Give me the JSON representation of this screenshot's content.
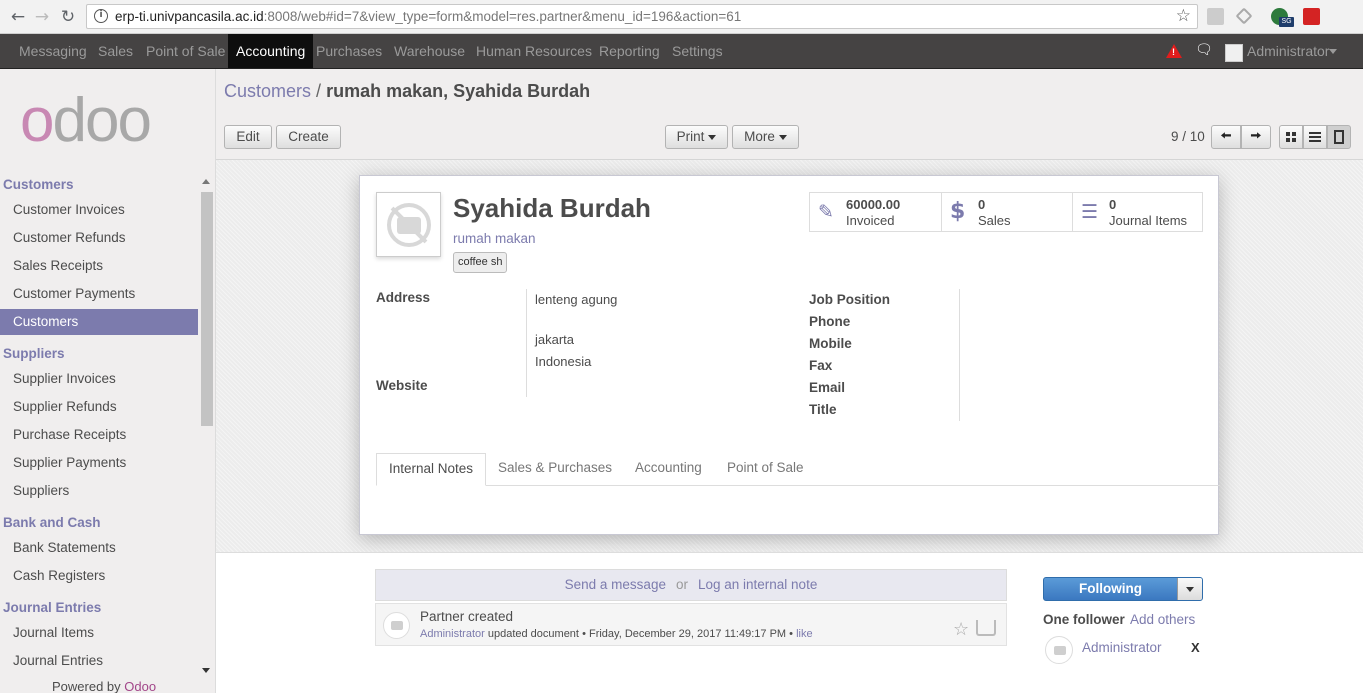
{
  "browser": {
    "url_host": "erp-ti.univpancasila.ac.id",
    "url_rest": ":8008/web#id=7&view_type=form&model=res.partner&menu_id=196&action=61",
    "back_icon": "arrow-left-icon",
    "forward_icon": "arrow-right-icon",
    "reload_icon": "reload-icon",
    "ext_badge": "SG"
  },
  "topbar": {
    "menus": [
      "Messaging",
      "Sales",
      "Point of Sale",
      "Accounting",
      "Purchases",
      "Warehouse",
      "Human Resources",
      "Reporting",
      "Settings"
    ],
    "active_menu": "Accounting",
    "user": "Administrator"
  },
  "sidebar": {
    "logo": "odoo",
    "sections": [
      {
        "title": "Customers",
        "items": [
          "Customer Invoices",
          "Customer Refunds",
          "Sales Receipts",
          "Customer Payments",
          "Customers"
        ]
      },
      {
        "title": "Suppliers",
        "items": [
          "Supplier Invoices",
          "Supplier Refunds",
          "Purchase Receipts",
          "Supplier Payments",
          "Suppliers"
        ]
      },
      {
        "title": "Bank and Cash",
        "items": [
          "Bank Statements",
          "Cash Registers"
        ]
      },
      {
        "title": "Journal Entries",
        "items": [
          "Journal Items",
          "Journal Entries"
        ]
      }
    ],
    "active_item": "Customers",
    "powered_prefix": "Powered by",
    "powered_brand": "Odoo"
  },
  "header": {
    "breadcrumb_link": "Customers",
    "breadcrumb_sep": "/",
    "breadcrumb_current": "rumah makan, Syahida Burdah",
    "edit_label": "Edit",
    "create_label": "Create",
    "print_label": "Print",
    "more_label": "More",
    "pager": "9 / 10"
  },
  "form": {
    "name": "Syahida Burdah",
    "parent": "rumah makan",
    "tag": "coffee sh",
    "stats": [
      {
        "value": "60000.00",
        "label": "Invoiced",
        "icon": "edit-icon"
      },
      {
        "value": "0",
        "label": "Sales",
        "icon": "dollar-icon"
      },
      {
        "value": "0",
        "label": "Journal Items",
        "icon": "list-icon"
      }
    ],
    "labels": {
      "address": "Address",
      "website": "Website",
      "job_position": "Job Position",
      "phone": "Phone",
      "mobile": "Mobile",
      "fax": "Fax",
      "email": "Email",
      "title": "Title"
    },
    "address": {
      "street": "lenteng agung",
      "city": "jakarta",
      "country": "Indonesia"
    },
    "tabs": [
      "Internal Notes",
      "Sales & Purchases",
      "Accounting",
      "Point of Sale"
    ],
    "active_tab": "Internal Notes"
  },
  "chatter": {
    "send_message": "Send a message",
    "or": "or",
    "log_note": "Log an internal note",
    "message": {
      "body": "Partner created",
      "author": "Administrator",
      "action": "updated document",
      "date": "Friday, December 29, 2017 11:49:17 PM",
      "like": "like"
    },
    "following_label": "Following",
    "follower_count": "One follower",
    "add_others": "Add others",
    "followers": [
      "Administrator"
    ],
    "remove_label": "X"
  },
  "colors": {
    "brand": "#7c7bad",
    "topbar": "#454343",
    "primary_button": "#3b78c0",
    "alert": "#e21c1c"
  }
}
